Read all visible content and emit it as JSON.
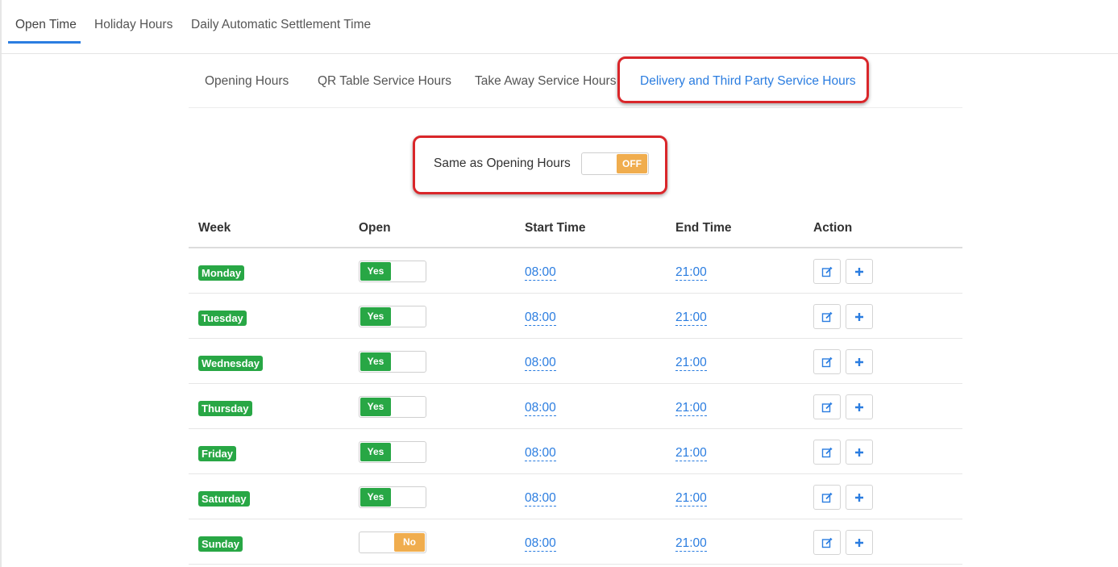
{
  "top_tabs": [
    {
      "label": "Open Time",
      "active": true
    },
    {
      "label": "Holiday Hours",
      "active": false
    },
    {
      "label": "Daily Automatic Settlement Time",
      "active": false
    }
  ],
  "sub_tabs": [
    {
      "label": "Opening Hours",
      "active": false
    },
    {
      "label": "QR Table Service Hours",
      "active": false
    },
    {
      "label": "Take Away Service Hours",
      "active": false
    },
    {
      "label": "Delivery and Third Party Service Hours",
      "active": true
    }
  ],
  "same_as_opening": {
    "label": "Same as Opening Hours",
    "state": "OFF"
  },
  "table": {
    "headers": {
      "week": "Week",
      "open": "Open",
      "start": "Start Time",
      "end": "End Time",
      "action": "Action"
    },
    "rows": [
      {
        "day": "Monday",
        "open": "Yes",
        "start": "08:00",
        "end": "21:00"
      },
      {
        "day": "Tuesday",
        "open": "Yes",
        "start": "08:00",
        "end": "21:00"
      },
      {
        "day": "Wednesday",
        "open": "Yes",
        "start": "08:00",
        "end": "21:00"
      },
      {
        "day": "Thursday",
        "open": "Yes",
        "start": "08:00",
        "end": "21:00"
      },
      {
        "day": "Friday",
        "open": "Yes",
        "start": "08:00",
        "end": "21:00"
      },
      {
        "day": "Saturday",
        "open": "Yes",
        "start": "08:00",
        "end": "21:00"
      },
      {
        "day": "Sunday",
        "open": "No",
        "start": "08:00",
        "end": "21:00"
      }
    ]
  },
  "icons": {
    "edit": "edit-icon",
    "add": "plus-icon"
  },
  "colors": {
    "accent": "#2b7de0",
    "yes": "#28a745",
    "no": "#f0ad4e",
    "highlight": "#d9262a"
  }
}
